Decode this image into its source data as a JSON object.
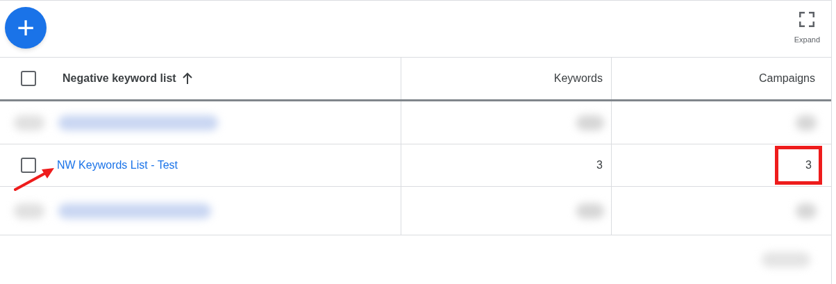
{
  "toolbar": {
    "add_button": {
      "label": "+"
    },
    "expand": {
      "label": "Expand"
    }
  },
  "table": {
    "header": {
      "checked": false
    },
    "columns": [
      {
        "label": "Negative keyword list",
        "sorted": true
      },
      {
        "label": "Keywords",
        "sorted": false
      },
      {
        "label": "Campaigns",
        "sorted": false
      }
    ],
    "rows": [
      {
        "kind": "blurred"
      },
      {
        "kind": "item",
        "checked": false,
        "name": "NW Keywords List - Test",
        "keywords": "3",
        "campaigns": "3",
        "highlight_campaigns": true,
        "arrow": true
      },
      {
        "kind": "blurred"
      }
    ]
  }
}
